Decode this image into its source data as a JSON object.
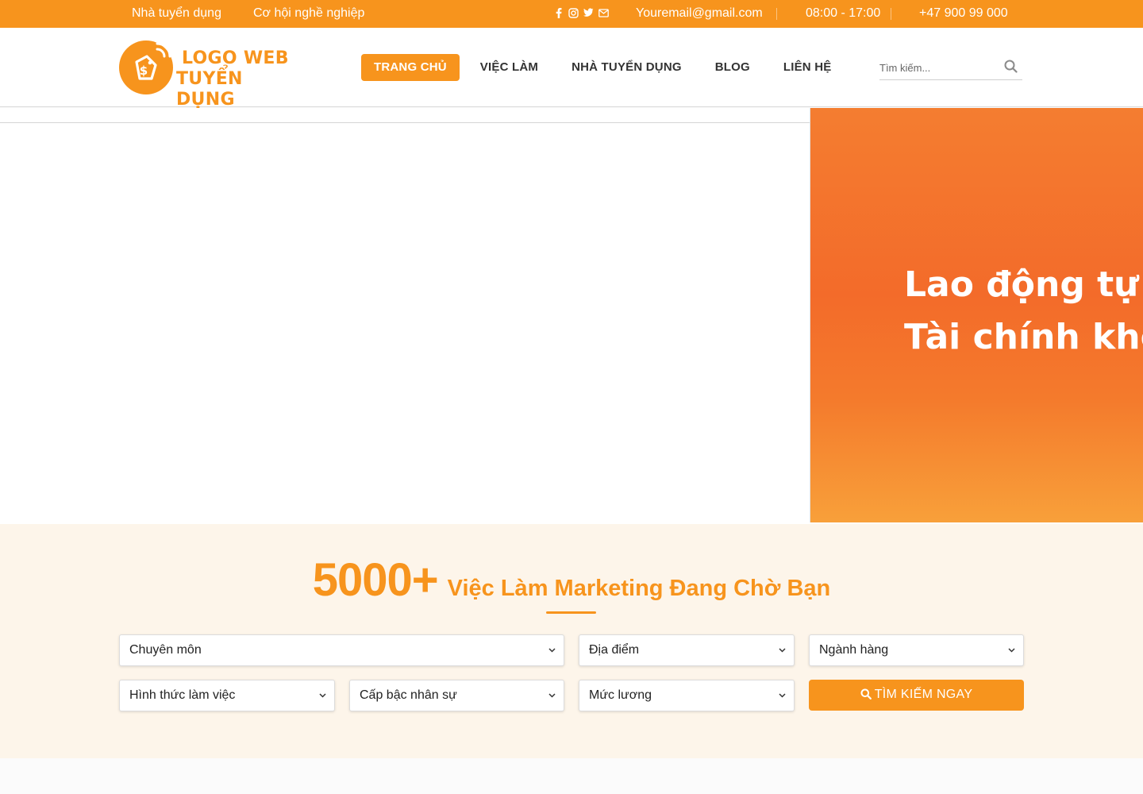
{
  "topbar": {
    "link_employers": "Nhà tuyển dụng",
    "link_career": "Cơ hội nghề nghiệp",
    "email": "Youremail@gmail.com",
    "hours": "08:00 - 17:00",
    "phone": "+47 900 99 000",
    "social_icons": [
      "facebook-icon",
      "instagram-icon",
      "twitter-icon",
      "envelope-icon"
    ]
  },
  "header": {
    "logo_line1": "LOGO WEB",
    "logo_line2": "TUYỂN DỤNG",
    "nav": [
      {
        "label": "TRANG CHỦ",
        "active": true
      },
      {
        "label": "VIỆC LÀM"
      },
      {
        "label": "NHÀ TUYỂN DỤNG"
      },
      {
        "label": "BLOG"
      },
      {
        "label": "LIÊN HỆ"
      }
    ],
    "search_placeholder": "Tìm kiếm..."
  },
  "banner": {
    "line1": "Lao động tự c",
    "line2": "Tài chính khô"
  },
  "jobsearch": {
    "count": "5000+",
    "headline": "Việc Làm Marketing Đang Chờ Bạn",
    "filters": {
      "specialty": "Chuyên môn",
      "location": "Địa điểm",
      "industry": "Ngành hàng",
      "work_type": "Hình thức làm việc",
      "level": "Cấp bậc nhân sự",
      "salary": "Mức lương"
    },
    "submit_label": "TÌM KIẾM NGAY"
  },
  "colors": {
    "brand": "#f7941d",
    "section_bg": "#fdf5ea"
  }
}
